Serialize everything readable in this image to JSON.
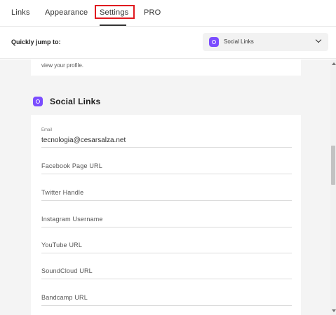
{
  "tabs": {
    "links": "Links",
    "appearance": "Appearance",
    "settings": "Settings",
    "pro": "PRO",
    "active": "Settings"
  },
  "jump": {
    "label": "Quickly jump to:",
    "selected": "Social Links",
    "icon": "social-links-icon"
  },
  "previous_section": {
    "text": "view your profile."
  },
  "section": {
    "title": "Social Links",
    "icon": "social-links-icon",
    "accent_color": "#7b4dff"
  },
  "fields": {
    "email": {
      "label": "Email",
      "value": "tecnologia@cesarsalza.net"
    },
    "facebook": {
      "placeholder": "Facebook Page URL"
    },
    "twitter": {
      "placeholder": "Twitter Handle"
    },
    "instagram": {
      "placeholder": "Instagram Username"
    },
    "youtube": {
      "placeholder": "YouTube URL"
    },
    "soundcloud": {
      "placeholder": "SoundCloud URL"
    },
    "bandcamp": {
      "placeholder": "Bandcamp URL"
    }
  },
  "highlight_color": "#e0191f"
}
